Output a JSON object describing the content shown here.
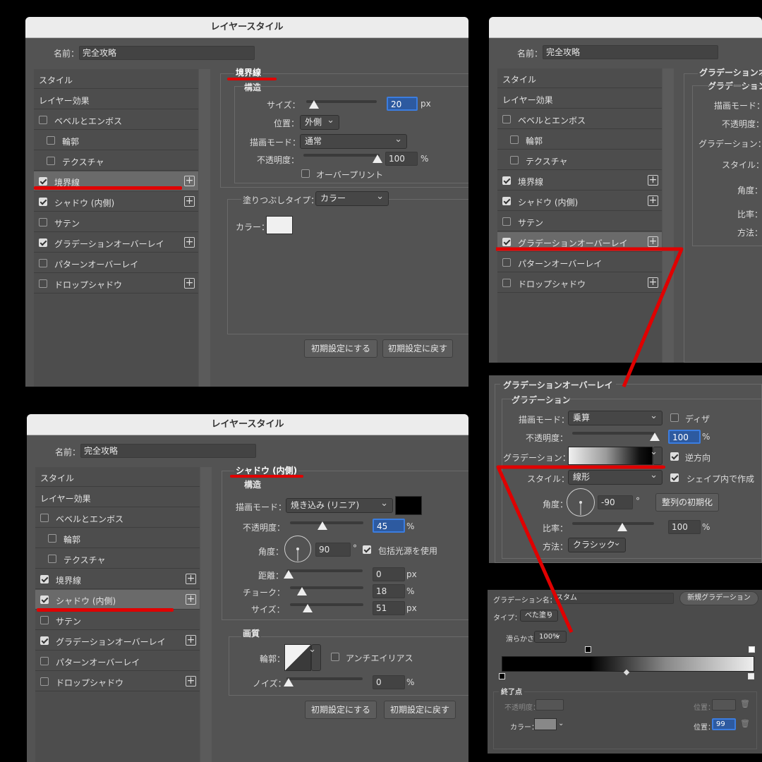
{
  "panel1": {
    "title": "レイヤースタイル",
    "name_label": "名前：",
    "name_value": "完全攻略",
    "section": "境界線",
    "structure": "構造",
    "size_label": "サイズ：",
    "size_value": "20",
    "size_unit": "px",
    "position_label": "位置：",
    "position_value": "外側",
    "blend_label": "描画モード：",
    "blend_value": "通常",
    "opacity_label": "不透明度：",
    "opacity_value": "100",
    "opacity_unit": "%",
    "overprint": "オーバープリント",
    "fill_type_label": "塗りつぶしタイプ：",
    "fill_type_value": "カラー",
    "color_label": "カラー：",
    "reset_default": "初期設定にする",
    "restore_default": "初期設定に戻す"
  },
  "styles_list": {
    "styles": "スタイル",
    "layer_effects": "レイヤー効果",
    "bevel": "ベベルとエンボス",
    "contour": "輪郭",
    "texture": "テクスチャ",
    "stroke": "境界線",
    "inner_shadow": "シャドウ (内側)",
    "satin": "サテン",
    "gradient_overlay": "グラデーションオーバーレイ",
    "pattern_overlay": "パターンオーバーレイ",
    "drop_shadow": "ドロップシャドウ"
  },
  "panel2": {
    "name_label": "名前：",
    "name_value": "完全攻略",
    "section_partial": "グラデーションオ",
    "sub_partial": "グラデーション",
    "blend_label": "描画モード：",
    "opacity_label": "不透明度：",
    "gradient_label": "グラデーション：",
    "style_label": "スタイル：",
    "angle_label": "角度：",
    "scale_label": "比率：",
    "method_label": "方法："
  },
  "panel3": {
    "title": "レイヤースタイル",
    "name_label": "名前：",
    "name_value": "完全攻略",
    "section": "シャドウ (内側)",
    "structure": "構造",
    "blend_label": "描画モード：",
    "blend_value": "焼き込み (リニア)",
    "opacity_label": "不透明度：",
    "opacity_value": "45",
    "opacity_unit": "%",
    "angle_label": "角度：",
    "angle_value": "90",
    "angle_unit": "°",
    "global_light": "包括光源を使用",
    "distance_label": "距離：",
    "distance_value": "0",
    "distance_unit": "px",
    "choke_label": "チョーク：",
    "choke_value": "18",
    "choke_unit": "%",
    "size_label": "サイズ：",
    "size_value": "51",
    "size_unit": "px",
    "quality": "画質",
    "contour_label": "輪郭：",
    "antialias": "アンチエイリアス",
    "noise_label": "ノイズ：",
    "noise_value": "0",
    "noise_unit": "%",
    "reset_default": "初期設定にする",
    "restore_default": "初期設定に戻す"
  },
  "panel4": {
    "section": "グラデーションオーバーレイ",
    "sub": "グラデーション",
    "blend_label": "描画モード：",
    "blend_value": "乗算",
    "dither": "ディザ",
    "opacity_label": "不透明度：",
    "opacity_value": "100",
    "opacity_unit": "%",
    "gradient_label": "グラデーション：",
    "reverse": "逆方向",
    "style_label": "スタイル：",
    "style_value": "線形",
    "align_with_layer": "シェイプ内で作成",
    "angle_label": "角度：",
    "angle_value": "-90",
    "angle_unit": "°",
    "reset_alignment": "整列の初期化",
    "scale_label": "比率：",
    "scale_value": "100",
    "scale_unit": "%",
    "method_label": "方法：",
    "method_value": "クラシック"
  },
  "panel5": {
    "name_label": "グラデーション名：",
    "name_value": "スタム",
    "new_gradient": "新規グラデーション",
    "type_label": "タイプ：",
    "type_value": "べた塗り",
    "smoothness_label": "滑らかさ：",
    "smoothness_value": "100%",
    "stops_label": "終了点",
    "opacity_label": "不透明度：",
    "location_label": "位置：",
    "color_label": "カラー：",
    "location2_label": "位置：",
    "location2_value": "99"
  },
  "colors": {
    "annotation_red": "#e00000",
    "panel_bg": "#535353",
    "highlight_blue": "#2d5aa0"
  }
}
